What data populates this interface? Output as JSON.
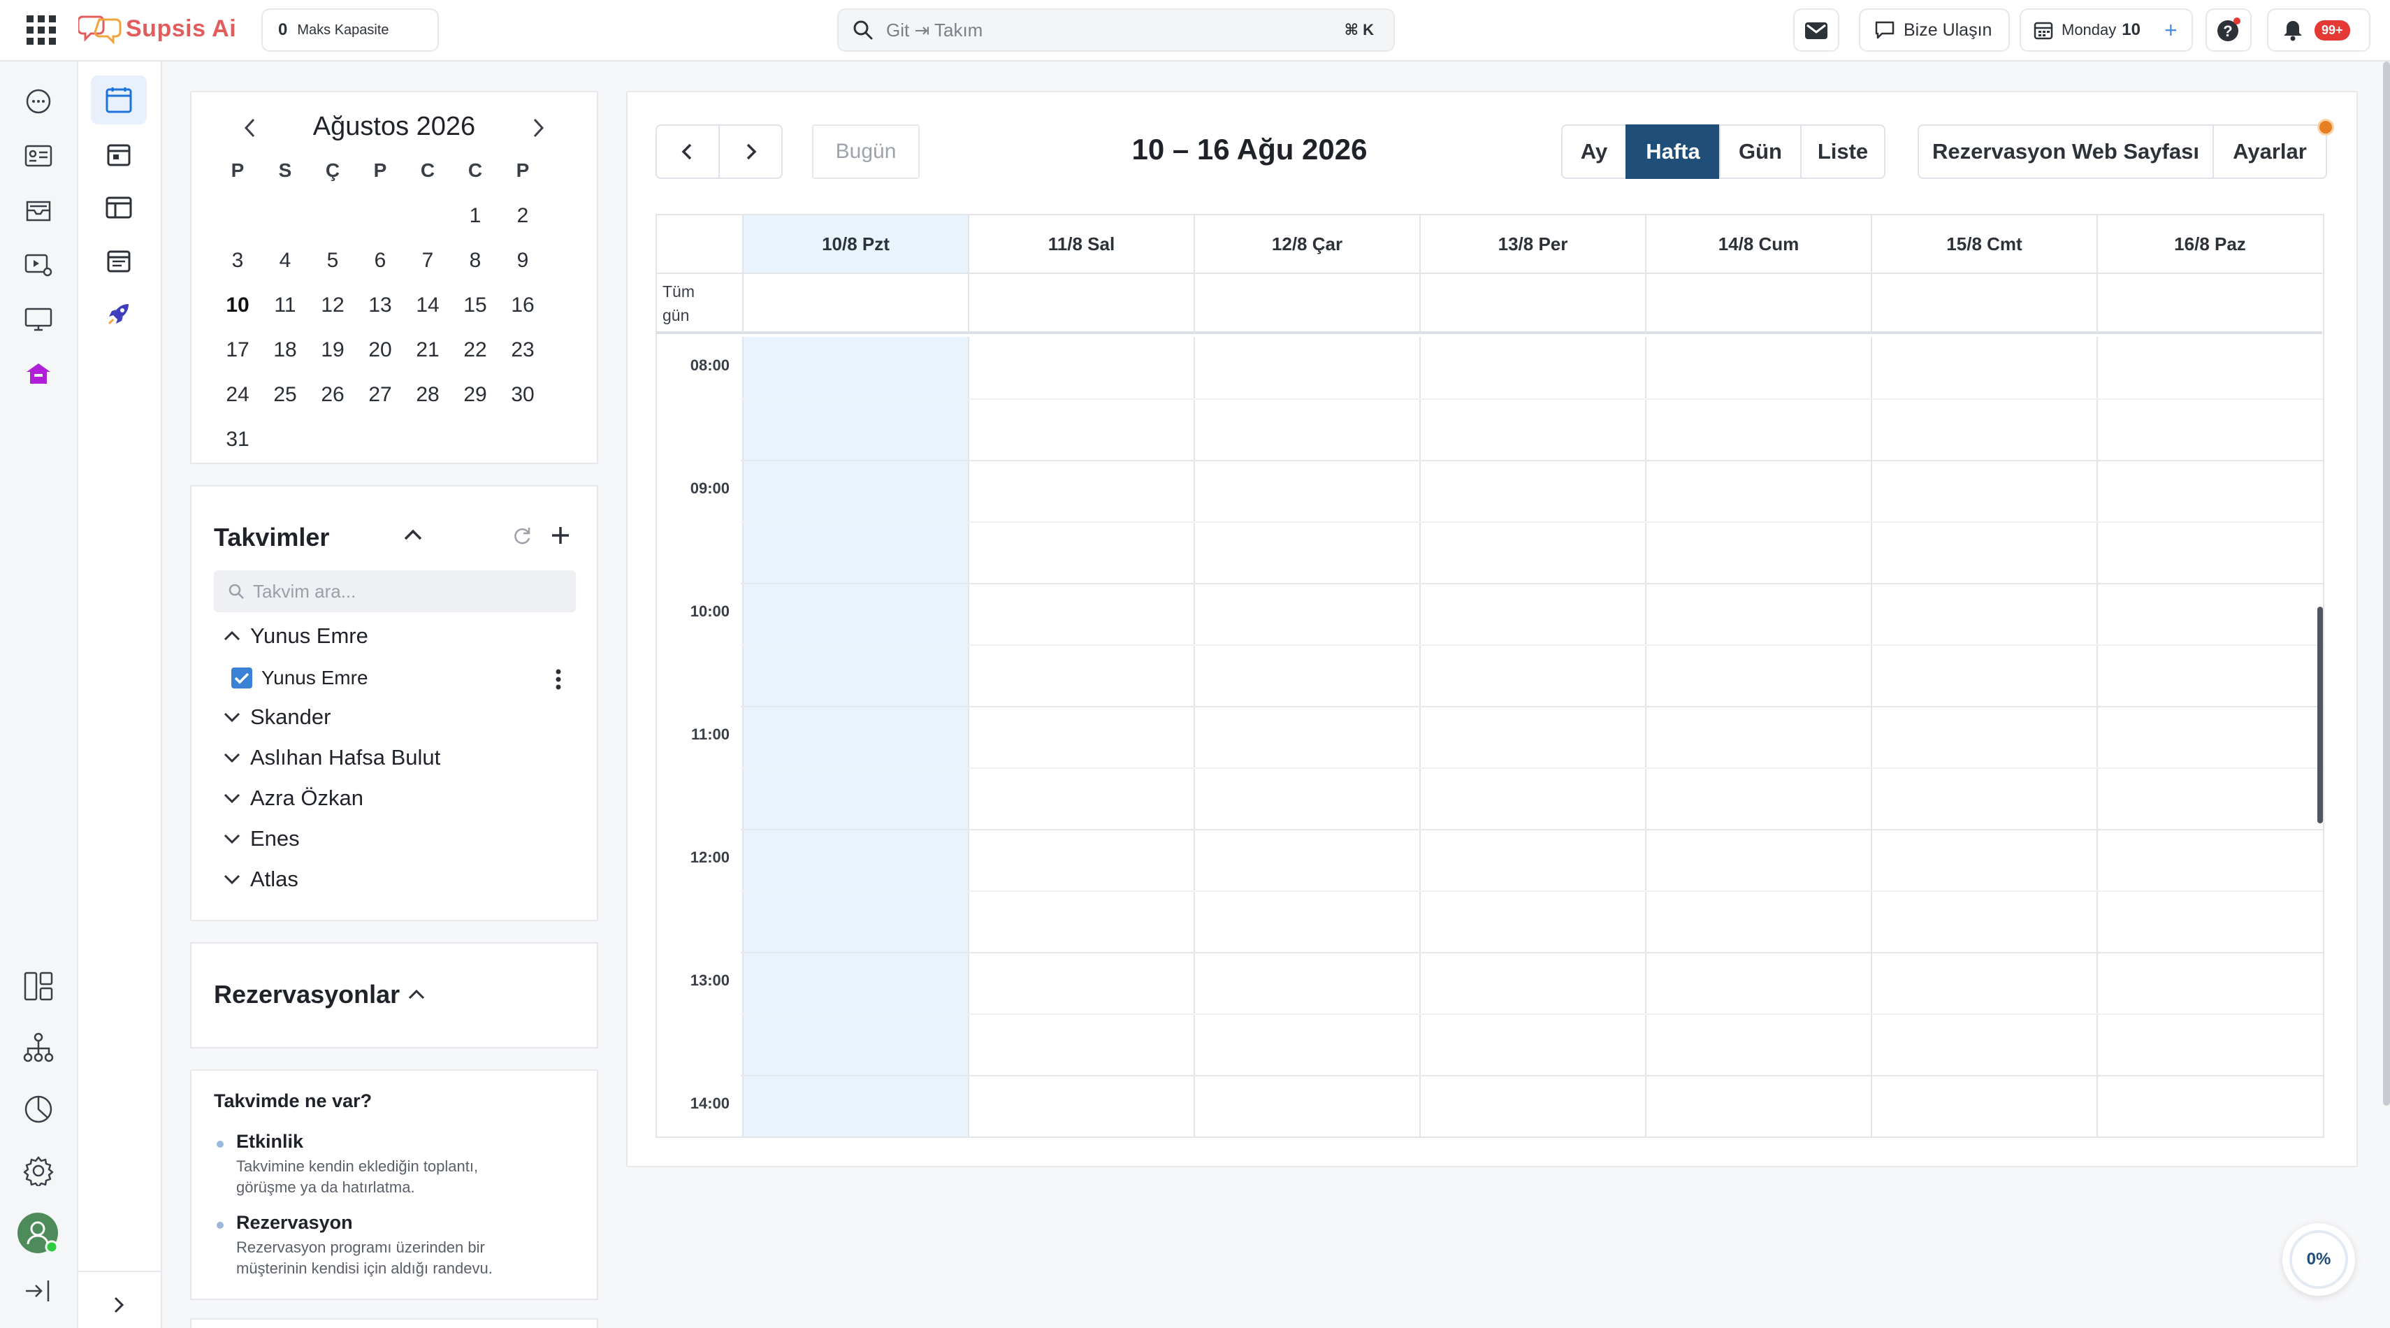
{
  "app": {
    "name": "Supsis Ai"
  },
  "topbar": {
    "capacity_value": "0",
    "capacity_label": "Maks Kapasite",
    "search_placeholder": "Git ⇥ Takım",
    "search_shortcut": "⌘ K",
    "contact_label": "Bize Ulaşın",
    "date_day": "Monday",
    "date_num": "10",
    "notif_badge": "99+"
  },
  "mini_calendar": {
    "title": "Ağustos 2026",
    "weekdays": [
      "P",
      "S",
      "Ç",
      "P",
      "C",
      "C",
      "P"
    ],
    "weeks": [
      [
        "",
        "",
        "",
        "",
        "",
        "1",
        "2"
      ],
      [
        "3",
        "4",
        "5",
        "6",
        "7",
        "8",
        "9"
      ],
      [
        "10",
        "11",
        "12",
        "13",
        "14",
        "15",
        "16"
      ],
      [
        "17",
        "18",
        "19",
        "20",
        "21",
        "22",
        "23"
      ],
      [
        "24",
        "25",
        "26",
        "27",
        "28",
        "29",
        "30"
      ],
      [
        "31",
        "",
        "",
        "",
        "",
        "",
        ""
      ]
    ],
    "today": "10"
  },
  "calendars": {
    "title": "Takvimler",
    "search_placeholder": "Takvim ara...",
    "groups": [
      {
        "label": "Yunus Emre",
        "expanded": true
      },
      {
        "label": "Skander",
        "expanded": false
      },
      {
        "label": "Aslıhan Hafsa Bulut",
        "expanded": false
      },
      {
        "label": "Azra Özkan",
        "expanded": false
      },
      {
        "label": "Enes",
        "expanded": false
      },
      {
        "label": "Atlas",
        "expanded": false
      }
    ],
    "sub_item": {
      "label": "Yunus Emre",
      "checked": true
    }
  },
  "reservations": {
    "title": "Rezervasyonlar"
  },
  "info": {
    "title": "Takvimde ne var?",
    "items": [
      {
        "title": "Etkinlik",
        "line1": "Takvimine kendin eklediğin toplantı,",
        "line2": "görüşme ya da hatırlatma."
      },
      {
        "title": "Rezervasyon",
        "line1": "Rezervasyon programı üzerinden bir",
        "line2": "müşterinin kendisi için aldığı randevu."
      }
    ]
  },
  "main": {
    "today_label": "Bugün",
    "range_title": "10 – 16 Ağu 2026",
    "views": [
      "Ay",
      "Hafta",
      "Gün",
      "Liste"
    ],
    "active_view": "Hafta",
    "booking_page_label": "Rezervasyon Web Sayfası",
    "settings_label": "Ayarlar",
    "all_day_label_1": "Tüm",
    "all_day_label_2": "gün",
    "days": [
      "10/8 Pzt",
      "11/8 Sal",
      "12/8 Çar",
      "13/8 Per",
      "14/8 Cum",
      "15/8 Cmt",
      "16/8 Paz"
    ],
    "highlight_day": "10/8 Pzt",
    "hours": [
      "08:00",
      "09:00",
      "10:00",
      "11:00",
      "12:00",
      "13:00",
      "14:00"
    ]
  },
  "progress": {
    "label": "0%",
    "value": 0
  },
  "colors": {
    "accent": "#1f4e79",
    "today_column": "#e8f3fd",
    "brand": "#e25c5c",
    "badge": "#e53935"
  }
}
